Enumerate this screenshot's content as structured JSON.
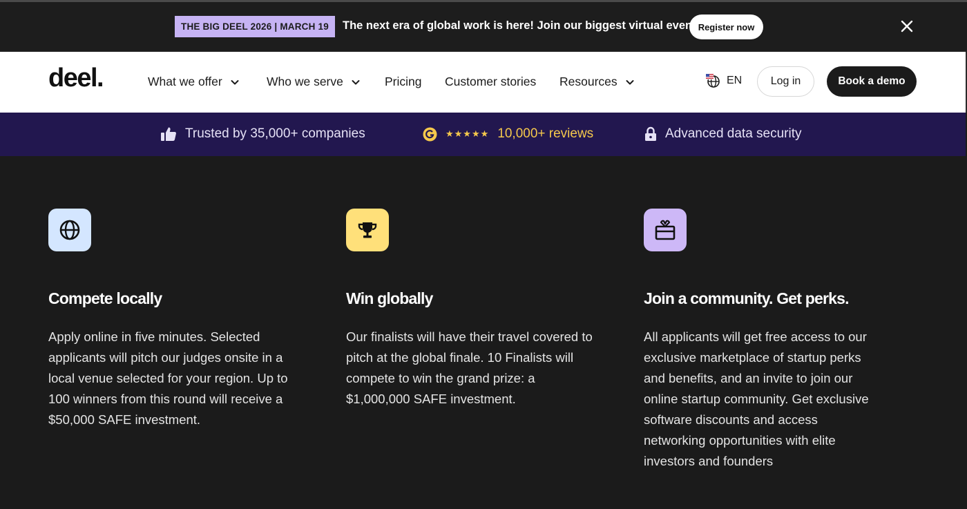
{
  "announcement": {
    "tag": "THE BIG DEEL 2026 | MARCH 19",
    "message": "The next era of global work is here! Join our biggest virtual event",
    "register_label": "Register now"
  },
  "nav": {
    "logo": "deel.",
    "items": [
      {
        "label": "What we offer",
        "dropdown": true
      },
      {
        "label": "Who we serve",
        "dropdown": true
      },
      {
        "label": "Pricing",
        "dropdown": false
      },
      {
        "label": "Customer stories",
        "dropdown": false
      },
      {
        "label": "Resources",
        "dropdown": true
      }
    ],
    "language": "EN",
    "login_label": "Log in",
    "demo_label": "Book a demo"
  },
  "trust": {
    "companies": "Trusted by 35,000+ companies",
    "stars": "★★★★★",
    "reviews": "10,000+ reviews",
    "security": "Advanced data security"
  },
  "features": [
    {
      "icon": "globe-icon",
      "icon_bg": "#d4e6ff",
      "title": "Compete locally",
      "body": "Apply online in five minutes. Selected applicants will pitch our judges onsite in a local venue selected for your region. Up to 100 winners from this round will receive a $50,000 SAFE investment."
    },
    {
      "icon": "trophy-icon",
      "icon_bg": "#ffe07a",
      "title": "Win globally",
      "body": "Our finalists will have their travel covered to pitch at the global finale. 10 Finalists will compete to win the grand prize: a $1,000,000 SAFE investment."
    },
    {
      "icon": "gift-icon",
      "icon_bg": "#cdb8f7",
      "title": "Join a community. Get perks.",
      "body": "All applicants will get free access to our exclusive marketplace of startup perks and benefits, and an invite to join our online startup community. Get exclusive software discounts and access networking opportunities with elite investors and founders"
    }
  ],
  "colors": {
    "background": "#1b1b1b",
    "trust_strip": "#22174f",
    "tag_bg": "#c6b3f4",
    "gold": "#f5c84c"
  }
}
